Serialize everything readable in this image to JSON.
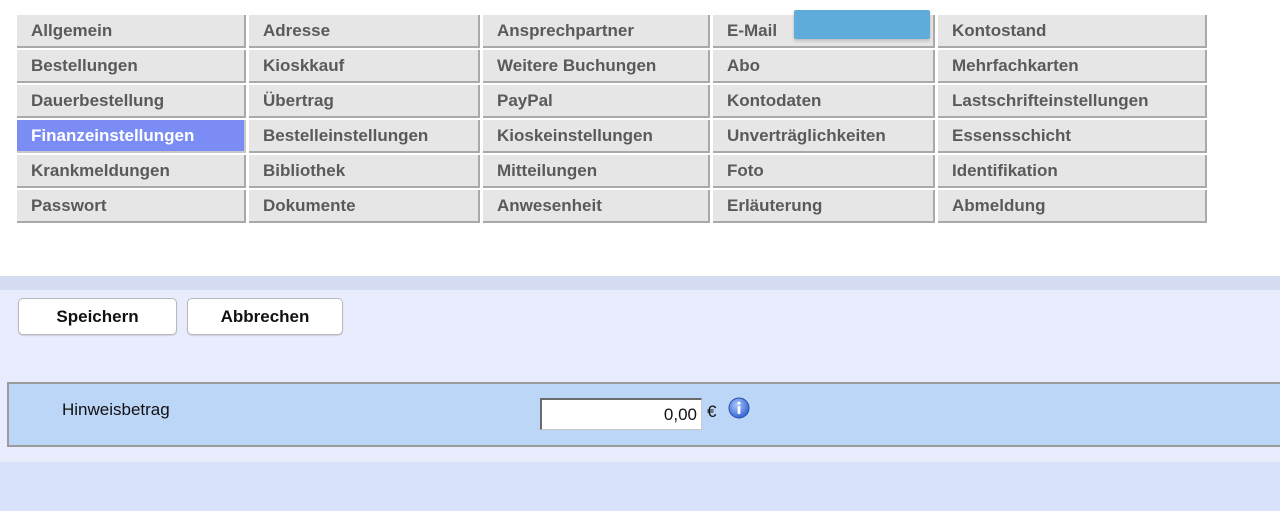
{
  "tabs": {
    "row1": [
      "Allgemein",
      "Adresse",
      "Ansprechpartner",
      "E-Mail",
      "Kontostand"
    ],
    "row2": [
      "Bestellungen",
      "Kioskkauf",
      "Weitere Buchungen",
      "Abo",
      "Mehrfachkarten"
    ],
    "row3": [
      "Dauerbestellung",
      "Übertrag",
      "PayPal",
      "Kontodaten",
      "Lastschrifteinstellungen"
    ],
    "row4": [
      "Finanzeinstellungen",
      "Bestelleinstellungen",
      "Kioskeinstellungen",
      "Unverträglichkeiten",
      "Essensschicht"
    ],
    "row5": [
      "Krankmeldungen",
      "Bibliothek",
      "Mitteilungen",
      "Foto",
      "Identifikation"
    ],
    "row6": [
      "Passwort",
      "Dokumente",
      "Anwesenheit",
      "Erläuterung",
      "Abmeldung"
    ],
    "active": "Finanzeinstellungen"
  },
  "toolbar": {
    "save_label": "Speichern",
    "cancel_label": "Abbrechen"
  },
  "form": {
    "hinweisbetrag": {
      "label": "Hinweisbetrag",
      "value": "0,00",
      "currency": "€",
      "info_icon": "info-icon"
    }
  },
  "colors": {
    "tab_bg": "#e6e6e6",
    "tab_active_bg": "#7b8cf4",
    "form_row_bg": "#bcd6f7",
    "panel_bg": "#e9ecfc",
    "overlay_box": "#5fabd9"
  }
}
